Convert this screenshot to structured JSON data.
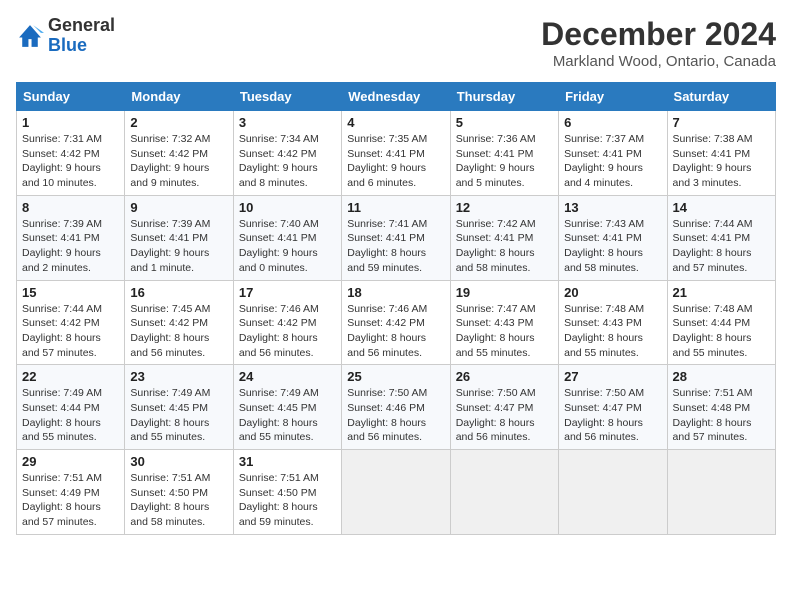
{
  "logo": {
    "general": "General",
    "blue": "Blue"
  },
  "title": "December 2024",
  "location": "Markland Wood, Ontario, Canada",
  "days_of_week": [
    "Sunday",
    "Monday",
    "Tuesday",
    "Wednesday",
    "Thursday",
    "Friday",
    "Saturday"
  ],
  "weeks": [
    [
      {
        "day": 1,
        "sunrise": "7:31 AM",
        "sunset": "4:42 PM",
        "daylight": "9 hours and 10 minutes."
      },
      {
        "day": 2,
        "sunrise": "7:32 AM",
        "sunset": "4:42 PM",
        "daylight": "9 hours and 9 minutes."
      },
      {
        "day": 3,
        "sunrise": "7:34 AM",
        "sunset": "4:42 PM",
        "daylight": "9 hours and 8 minutes."
      },
      {
        "day": 4,
        "sunrise": "7:35 AM",
        "sunset": "4:41 PM",
        "daylight": "9 hours and 6 minutes."
      },
      {
        "day": 5,
        "sunrise": "7:36 AM",
        "sunset": "4:41 PM",
        "daylight": "9 hours and 5 minutes."
      },
      {
        "day": 6,
        "sunrise": "7:37 AM",
        "sunset": "4:41 PM",
        "daylight": "9 hours and 4 minutes."
      },
      {
        "day": 7,
        "sunrise": "7:38 AM",
        "sunset": "4:41 PM",
        "daylight": "9 hours and 3 minutes."
      }
    ],
    [
      {
        "day": 8,
        "sunrise": "7:39 AM",
        "sunset": "4:41 PM",
        "daylight": "9 hours and 2 minutes."
      },
      {
        "day": 9,
        "sunrise": "7:39 AM",
        "sunset": "4:41 PM",
        "daylight": "9 hours and 1 minute."
      },
      {
        "day": 10,
        "sunrise": "7:40 AM",
        "sunset": "4:41 PM",
        "daylight": "9 hours and 0 minutes."
      },
      {
        "day": 11,
        "sunrise": "7:41 AM",
        "sunset": "4:41 PM",
        "daylight": "8 hours and 59 minutes."
      },
      {
        "day": 12,
        "sunrise": "7:42 AM",
        "sunset": "4:41 PM",
        "daylight": "8 hours and 58 minutes."
      },
      {
        "day": 13,
        "sunrise": "7:43 AM",
        "sunset": "4:41 PM",
        "daylight": "8 hours and 58 minutes."
      },
      {
        "day": 14,
        "sunrise": "7:44 AM",
        "sunset": "4:41 PM",
        "daylight": "8 hours and 57 minutes."
      }
    ],
    [
      {
        "day": 15,
        "sunrise": "7:44 AM",
        "sunset": "4:42 PM",
        "daylight": "8 hours and 57 minutes."
      },
      {
        "day": 16,
        "sunrise": "7:45 AM",
        "sunset": "4:42 PM",
        "daylight": "8 hours and 56 minutes."
      },
      {
        "day": 17,
        "sunrise": "7:46 AM",
        "sunset": "4:42 PM",
        "daylight": "8 hours and 56 minutes."
      },
      {
        "day": 18,
        "sunrise": "7:46 AM",
        "sunset": "4:42 PM",
        "daylight": "8 hours and 56 minutes."
      },
      {
        "day": 19,
        "sunrise": "7:47 AM",
        "sunset": "4:43 PM",
        "daylight": "8 hours and 55 minutes."
      },
      {
        "day": 20,
        "sunrise": "7:48 AM",
        "sunset": "4:43 PM",
        "daylight": "8 hours and 55 minutes."
      },
      {
        "day": 21,
        "sunrise": "7:48 AM",
        "sunset": "4:44 PM",
        "daylight": "8 hours and 55 minutes."
      }
    ],
    [
      {
        "day": 22,
        "sunrise": "7:49 AM",
        "sunset": "4:44 PM",
        "daylight": "8 hours and 55 minutes."
      },
      {
        "day": 23,
        "sunrise": "7:49 AM",
        "sunset": "4:45 PM",
        "daylight": "8 hours and 55 minutes."
      },
      {
        "day": 24,
        "sunrise": "7:49 AM",
        "sunset": "4:45 PM",
        "daylight": "8 hours and 55 minutes."
      },
      {
        "day": 25,
        "sunrise": "7:50 AM",
        "sunset": "4:46 PM",
        "daylight": "8 hours and 56 minutes."
      },
      {
        "day": 26,
        "sunrise": "7:50 AM",
        "sunset": "4:47 PM",
        "daylight": "8 hours and 56 minutes."
      },
      {
        "day": 27,
        "sunrise": "7:50 AM",
        "sunset": "4:47 PM",
        "daylight": "8 hours and 56 minutes."
      },
      {
        "day": 28,
        "sunrise": "7:51 AM",
        "sunset": "4:48 PM",
        "daylight": "8 hours and 57 minutes."
      }
    ],
    [
      {
        "day": 29,
        "sunrise": "7:51 AM",
        "sunset": "4:49 PM",
        "daylight": "8 hours and 57 minutes."
      },
      {
        "day": 30,
        "sunrise": "7:51 AM",
        "sunset": "4:50 PM",
        "daylight": "8 hours and 58 minutes."
      },
      {
        "day": 31,
        "sunrise": "7:51 AM",
        "sunset": "4:50 PM",
        "daylight": "8 hours and 59 minutes."
      },
      null,
      null,
      null,
      null
    ]
  ]
}
